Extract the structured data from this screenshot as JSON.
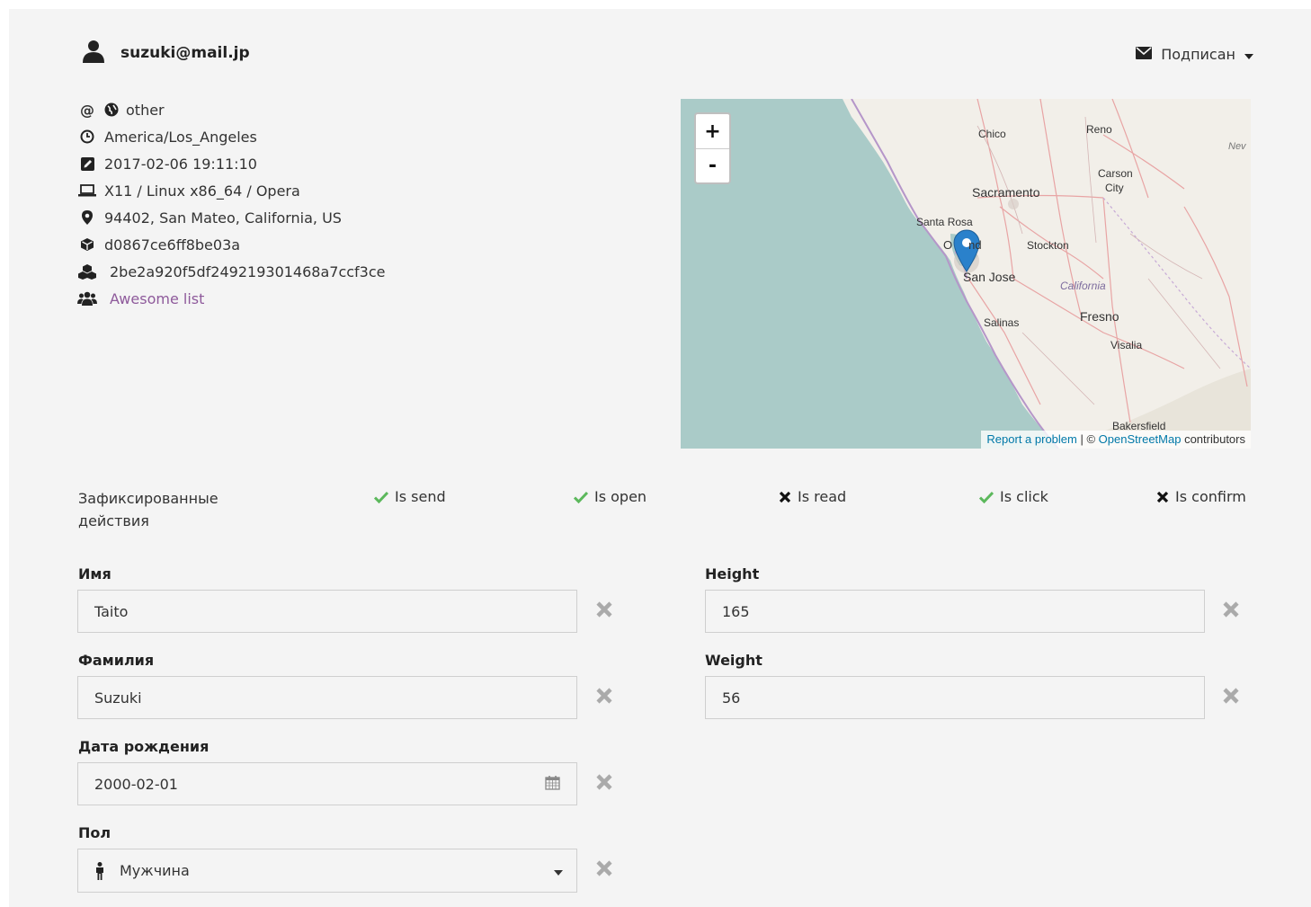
{
  "user": {
    "email": "suzuki@mail.jp"
  },
  "subscription": {
    "label": "Подписан"
  },
  "info": {
    "source": "other",
    "timezone": "America/Los_Angeles",
    "registered": "2017-02-06 19:11:10",
    "platform": "X11 / Linux x86_64 / Opera",
    "location": "94402, San Mateo, California, US",
    "device_id": "d0867ce6ff8be03a",
    "hash": "2be2a920f5df249219301468a7ccf3ce",
    "list_link": "Awesome list"
  },
  "map": {
    "zoom_in": "+",
    "zoom_out": "-",
    "report_link": "Report a problem",
    "attr_sep": " | © ",
    "osm_link": "OpenStreetMap",
    "attr_tail": " contributors",
    "places": {
      "chico": "Chico",
      "reno": "Reno",
      "nev": "Nev",
      "carson": "Carson",
      "city": "City",
      "sacramento": "Sacramento",
      "santarosa": "Santa Rosa",
      "oakland": "O     nd",
      "stockton": "Stockton",
      "sanjose": "San Jose",
      "california": "California",
      "fresno": "Fresno",
      "salinas": "Salinas",
      "visalia": "Visalia",
      "bakersfield": "Bakersfield"
    }
  },
  "actions": {
    "label": "Зафиксированные действия",
    "items": [
      {
        "label": "Is send",
        "state": true
      },
      {
        "label": "Is open",
        "state": true
      },
      {
        "label": "Is read",
        "state": false
      },
      {
        "label": "Is click",
        "state": true
      },
      {
        "label": "Is confirm",
        "state": false
      }
    ]
  },
  "fields": {
    "first_name": {
      "label": "Имя",
      "value": "Taito"
    },
    "last_name": {
      "label": "Фамилия",
      "value": "Suzuki"
    },
    "birth_date": {
      "label": "Дата рождения",
      "value": "2000-02-01"
    },
    "gender": {
      "label": "Пол",
      "value": "Мужчина"
    },
    "height": {
      "label": "Height",
      "value": "165"
    },
    "weight": {
      "label": "Weight",
      "value": "56"
    }
  },
  "colors": {
    "check": "#5cb85c",
    "cross": "#111111",
    "link": "#8e5a9b",
    "clear": "#aaaaaa"
  }
}
